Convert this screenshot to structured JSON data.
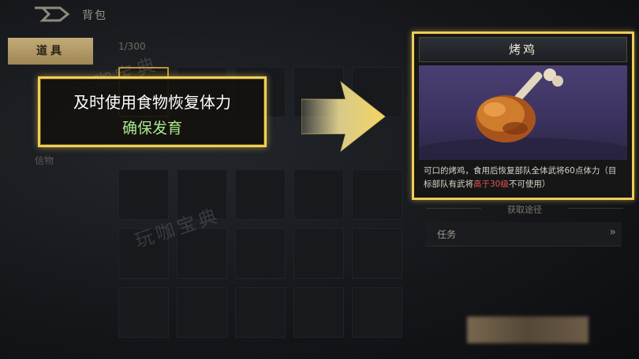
{
  "header": {
    "title": "背包"
  },
  "tabs": {
    "items_tab": "道具"
  },
  "inventory": {
    "count": "1/300",
    "category_label": "信物"
  },
  "callout": {
    "line1": "及时使用食物恢复体力",
    "line2": "确保发育"
  },
  "item_card": {
    "name": "烤鸡",
    "description_part1": "可口的烤鸡，食用后恢复部队全体武将60点体力（目标部队有武将",
    "description_highlight": "高于30级",
    "description_part2": "不可使用）"
  },
  "source": {
    "label": "获取途径",
    "row_label": "任务",
    "row_chevron": "»"
  },
  "watermark": {
    "text": "玩咖宝典"
  },
  "colors": {
    "gold_border": "#efcd56",
    "highlight_green": "#a6e88f",
    "warning_red": "#e05555"
  },
  "icons": {
    "back": "back-arrow-icon",
    "item": "roast-chicken-icon",
    "arrow": "pointing-arrow-icon"
  }
}
